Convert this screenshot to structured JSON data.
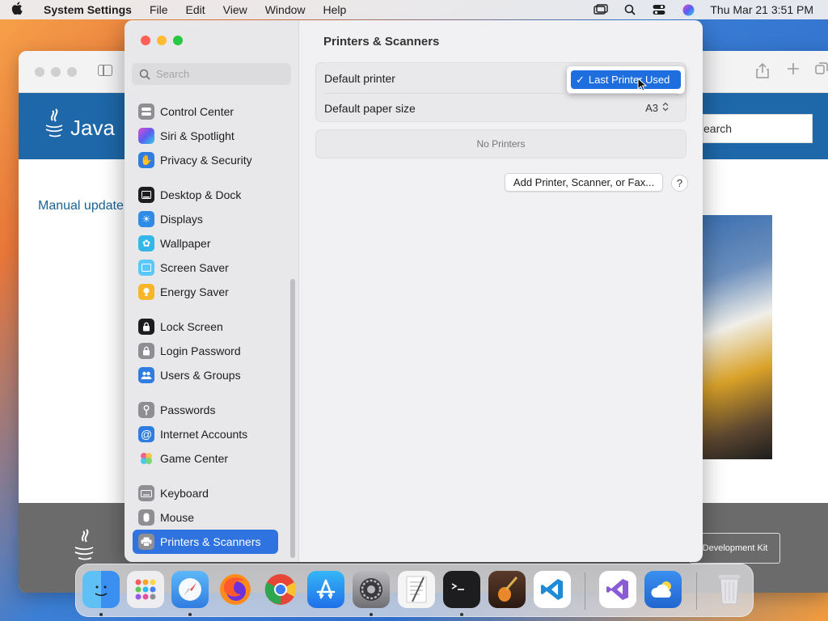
{
  "menubar": {
    "app_name": "System Settings",
    "items": [
      "File",
      "Edit",
      "View",
      "Window",
      "Help"
    ],
    "datetime": "Thu Mar 21  3:51 PM"
  },
  "browser": {
    "manual_update": "Manual update",
    "search_text": "earch",
    "jdk_label": "Development Kit",
    "java_logo": "Java"
  },
  "sidebar": {
    "search_placeholder": "Search",
    "items": [
      {
        "label": "Control Center",
        "icon": "control-center-icon",
        "color": "#8e8e93"
      },
      {
        "label": "Siri & Spotlight",
        "icon": "siri-icon",
        "color": "#7b3fe4"
      },
      {
        "label": "Privacy & Security",
        "icon": "hand-icon",
        "color": "#2f7de1"
      },
      {
        "label": "Desktop & Dock",
        "icon": "desktop-dock-icon",
        "color": "#1d1d1f"
      },
      {
        "label": "Displays",
        "icon": "displays-icon",
        "color": "#2f8ce6"
      },
      {
        "label": "Wallpaper",
        "icon": "wallpaper-icon",
        "color": "#35b6e8"
      },
      {
        "label": "Screen Saver",
        "icon": "screen-saver-icon",
        "color": "#5ac8fa"
      },
      {
        "label": "Energy Saver",
        "icon": "energy-saver-icon",
        "color": "#f7b52a"
      },
      {
        "label": "Lock Screen",
        "icon": "lock-icon",
        "color": "#1d1d1f"
      },
      {
        "label": "Login Password",
        "icon": "login-password-icon",
        "color": "#8e8e93"
      },
      {
        "label": "Users & Groups",
        "icon": "users-icon",
        "color": "#2f7de1"
      },
      {
        "label": "Passwords",
        "icon": "key-icon",
        "color": "#8e8e93"
      },
      {
        "label": "Internet Accounts",
        "icon": "at-icon",
        "color": "#2f7de1"
      },
      {
        "label": "Game Center",
        "icon": "game-center-icon",
        "color": "#f0f0f0"
      },
      {
        "label": "Keyboard",
        "icon": "keyboard-icon",
        "color": "#8e8e93"
      },
      {
        "label": "Mouse",
        "icon": "mouse-icon",
        "color": "#8e8e93"
      },
      {
        "label": "Printers & Scanners",
        "icon": "printer-icon",
        "color": "#8e8e93"
      }
    ]
  },
  "main": {
    "title": "Printers & Scanners",
    "default_printer_label": "Default printer",
    "default_printer_value": "Last Printer Used",
    "paper_size_label": "Default paper size",
    "paper_size_value": "A3",
    "no_printers": "No Printers",
    "add_button": "Add Printer, Scanner, or Fax...",
    "help_button": "?"
  },
  "dock": {
    "apps": [
      "Finder",
      "Launchpad",
      "Safari",
      "Firefox",
      "Chrome",
      "App Store",
      "System Settings",
      "TextEdit",
      "Terminal",
      "GarageBand",
      "Visual Studio Code",
      "Visual Studio",
      "Weather",
      "Trash"
    ]
  }
}
